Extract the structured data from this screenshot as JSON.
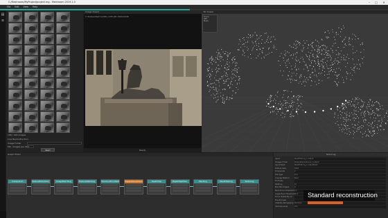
{
  "window": {
    "title": "C:/Meshroom/MyProject/project.mg - Meshroom 2019.1.0",
    "controls": [
      "–",
      "□",
      "✕"
    ]
  },
  "menu": {
    "items": [
      "File",
      "Edit",
      "View",
      "Help"
    ]
  },
  "progress": {
    "value": 0.49
  },
  "sidebar": {
    "icons": [
      "folder-icon",
      "list-icon"
    ]
  },
  "gallery": {
    "status_label": "196 / 196 images",
    "intrinsic_label": "Live Reconstruction",
    "image_folder_label": "Image Folder",
    "min_images_label": "Min. Images per Step",
    "min_images_value": "4",
    "start_button": "Start"
  },
  "viewer": {
    "title": "Image Viewer",
    "path": "C:/Dataset/Sphinx/IMG_1035.JPG  3264x2448",
    "footer": "Ready"
  },
  "viewer3d": {
    "title": "3D Viewer",
    "panel": [
      "Scene",
      "SfM",
      "Mesh"
    ]
  },
  "graph": {
    "title": "Graph Editor",
    "nodes": [
      "CameraInit",
      "FeatureExtraction",
      "ImageMatching",
      "FeatureMatching",
      "StructureFromMotion",
      "PrepareDenseScene",
      "DepthMap",
      "DepthMapFilter",
      "Meshing",
      "MeshFiltering",
      "Texturing"
    ],
    "selected": "PrepareDenseScene"
  },
  "node_editor": {
    "title": "Texturing",
    "rows": [
      {
        "key": "Input",
        "value": "MeshFiltering_1.output"
      },
      {
        "key": "Images Folder",
        "value": "PrepareDenseScene_1.output"
      },
      {
        "key": "Input Mesh",
        "value": "MeshFiltering_1.outputMesh"
      },
      {
        "key": "Texture Side",
        "value": "8192"
      },
      {
        "key": "Downscale",
        "value": "2"
      },
      {
        "key": "File Type",
        "value": "png"
      },
      {
        "key": "Unwrap Method",
        "value": "Basic"
      },
      {
        "key": "Fill Holes",
        "value": ""
      },
      {
        "key": "Padding",
        "value": "15"
      },
      {
        "key": "Max Nb Images",
        "value": "0"
      },
      {
        "key": "Best Score Threshold",
        "value": "0.1"
      },
      {
        "key": "Angle Hard Threshold",
        "value": "90.0"
      },
      {
        "key": "Force Visible By All",
        "value": ""
      },
      {
        "key": "Flip Normals",
        "value": ""
      },
      {
        "key": "Visibility Remapping",
        "value": "Pull-Push"
      },
      {
        "key": "Verbose Level",
        "value": "info"
      }
    ]
  },
  "overlay": {
    "caption": "Standard reconstruction"
  },
  "colors": {
    "accent": "#2aa79b",
    "node_header": "#3a8e8e",
    "selected_node": "#c9772b",
    "caption_bar": "#d9622b"
  }
}
